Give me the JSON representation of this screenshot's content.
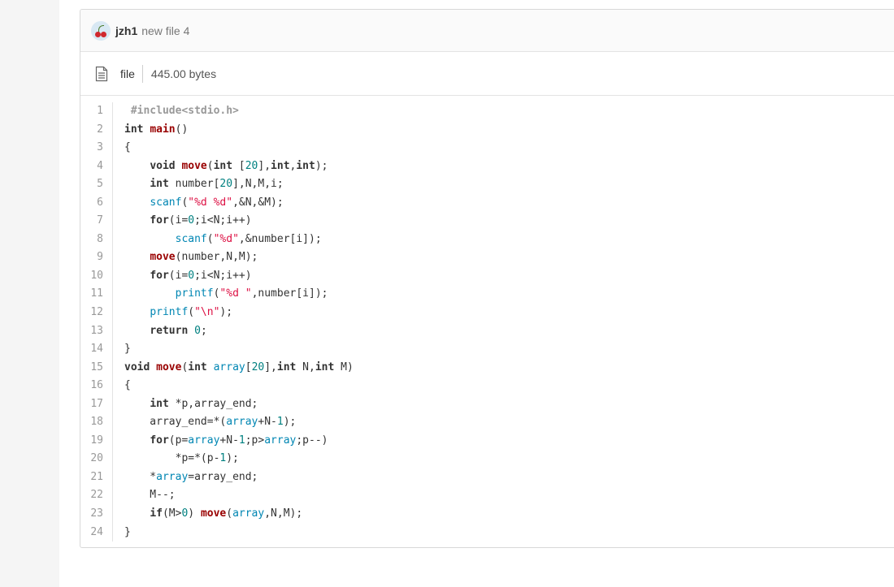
{
  "header": {
    "author": "jzh1",
    "message": "new file 4"
  },
  "file": {
    "type_label": "file",
    "size": "445.00 bytes"
  },
  "code": {
    "line_numbers": [
      "1",
      "2",
      "3",
      "4",
      "5",
      "6",
      "7",
      "8",
      "9",
      "10",
      "11",
      "12",
      "13",
      "14",
      "15",
      "16",
      "17",
      "18",
      "19",
      "20",
      "21",
      "22",
      "23",
      "24"
    ],
    "lines": [
      " #include<stdio.h>",
      "int main()",
      "{",
      "    void move(int [20],int,int);",
      "    int number[20],N,M,i;",
      "    scanf(\"%d %d\",&N,&M);",
      "    for(i=0;i<N;i++)",
      "        scanf(\"%d\",&number[i]);",
      "    move(number,N,M);",
      "    for(i=0;i<N;i++)",
      "        printf(\"%d \",number[i]);",
      "    printf(\"\\n\");",
      "    return 0;",
      "}",
      "void move(int array[20],int N,int M)",
      "{",
      "    int *p,array_end;",
      "    array_end=*(array+N-1);",
      "    for(p=array+N-1;p>array;p--)",
      "        *p=*(p-1);",
      "    *array=array_end;",
      "    M--;",
      "    if(M>0) move(array,N,M);",
      "}"
    ]
  },
  "icons": {
    "file": "file-text-icon",
    "avatar": "cherry-avatar"
  }
}
